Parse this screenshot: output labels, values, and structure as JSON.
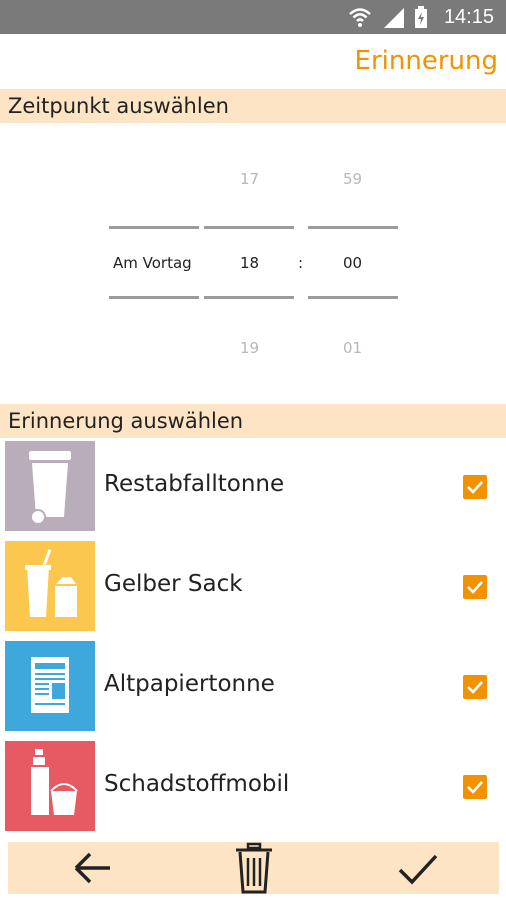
{
  "statusbar": {
    "time": "14:15"
  },
  "appbar": {
    "title": "Erinnerung"
  },
  "time_section": {
    "header": "Zeitpunkt auswählen"
  },
  "picker": {
    "day": {
      "value": "Am Vortag"
    },
    "hour": {
      "prev": "17",
      "value": "18",
      "next": "19"
    },
    "minute": {
      "prev": "59",
      "value": "00",
      "next": "01"
    },
    "separator": ":"
  },
  "reminder_section": {
    "header": "Erinnerung auswählen"
  },
  "reminders": [
    {
      "label": "Restabfalltonne",
      "checked": true,
      "color": "#b8adb9",
      "icon": "trash-bin-icon"
    },
    {
      "label": "Gelber Sack",
      "checked": true,
      "color": "#fbc74e",
      "icon": "cup-carton-icon"
    },
    {
      "label": "Altpapiertonne",
      "checked": true,
      "color": "#3ea8dc",
      "icon": "newspaper-icon"
    },
    {
      "label": "Schadstoffmobil",
      "checked": true,
      "color": "#e85a63",
      "icon": "spray-paint-icon"
    }
  ],
  "bottom_actions": [
    "back-arrow-icon",
    "trash-can-icon",
    "checkmark-icon"
  ],
  "colors": {
    "accent": "#f39200",
    "section_bg": "#fde4c4",
    "statusbar": "#7a7a7a"
  }
}
